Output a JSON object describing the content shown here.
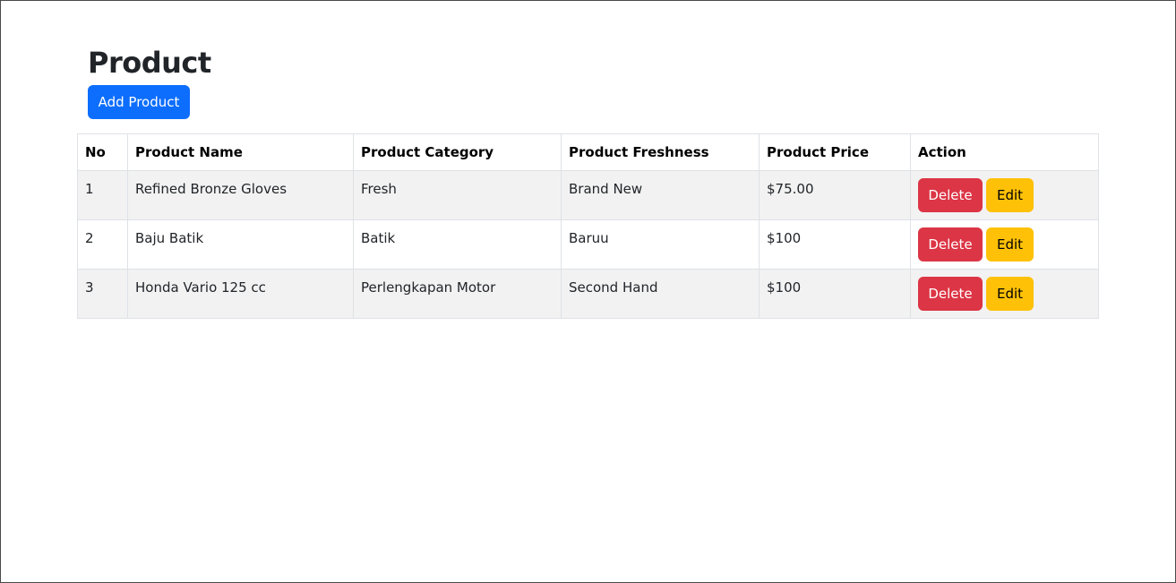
{
  "page": {
    "title": "Product",
    "add_button_label": "Add Product"
  },
  "table": {
    "headers": [
      "No",
      "Product Name",
      "Product Category",
      "Product Freshness",
      "Product Price",
      "Action"
    ],
    "rows": [
      {
        "no": "1",
        "name": "Refined Bronze Gloves",
        "category": "Fresh",
        "freshness": "Brand New",
        "price": "$75.00",
        "delete_label": "Delete",
        "edit_label": "Edit"
      },
      {
        "no": "2",
        "name": "Baju Batik",
        "category": "Batik",
        "freshness": "Baruu",
        "price": "$100",
        "delete_label": "Delete",
        "edit_label": "Edit"
      },
      {
        "no": "3",
        "name": "Honda Vario 125 cc",
        "category": "Perlengkapan Motor",
        "freshness": "Second Hand",
        "price": "$100",
        "delete_label": "Delete",
        "edit_label": "Edit"
      }
    ]
  },
  "colors": {
    "primary": "#0d6efd",
    "danger": "#dc3545",
    "warning": "#ffc107",
    "striped_row": "#f2f2f2"
  }
}
